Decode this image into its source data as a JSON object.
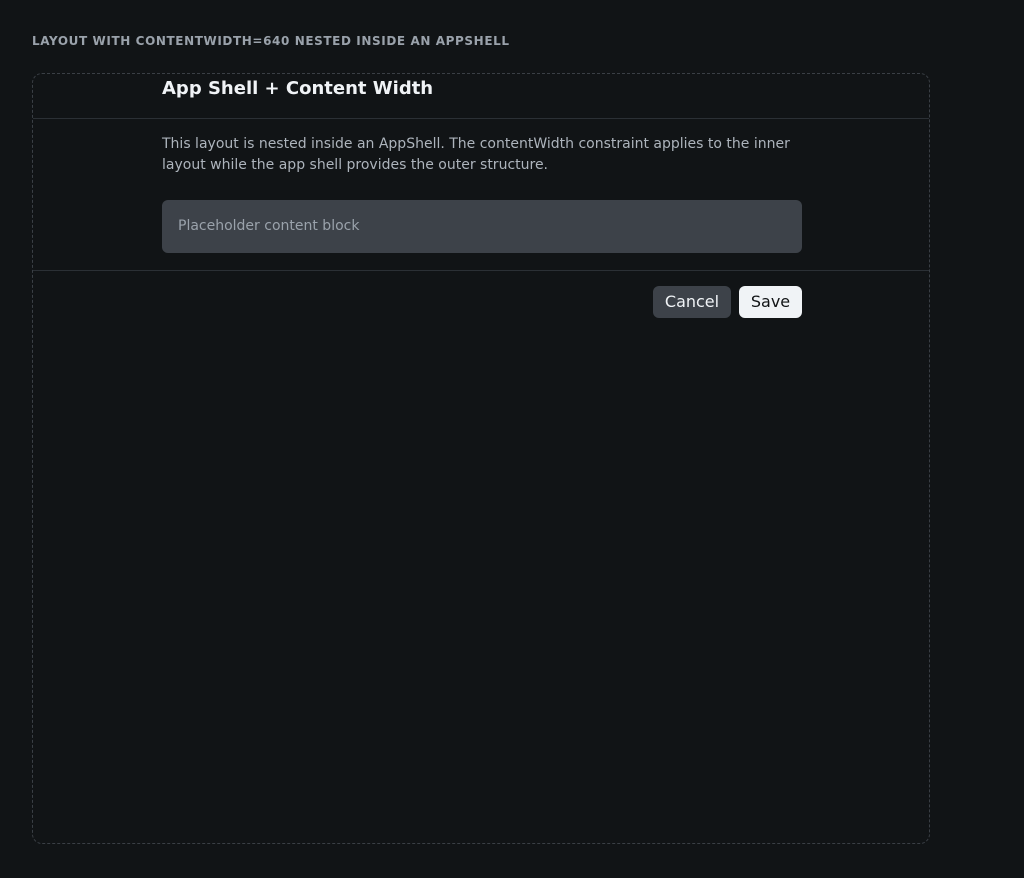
{
  "story": {
    "label": "LAYOUT WITH CONTENTWIDTH=640 NESTED INSIDE AN APPSHELL"
  },
  "header": {
    "title": "App Shell + Content Width"
  },
  "main": {
    "description": "This layout is nested inside an AppShell. The contentWidth constraint applies to the inner layout while the app shell provides the outer structure.",
    "placeholder": "Placeholder content block"
  },
  "footer": {
    "cancel_label": "Cancel",
    "save_label": "Save"
  },
  "colors": {
    "background": "#111416",
    "surface": "#3d4249",
    "text_primary": "#f0f3f6",
    "text_secondary": "#adb4bc",
    "border": "#2b3035"
  }
}
